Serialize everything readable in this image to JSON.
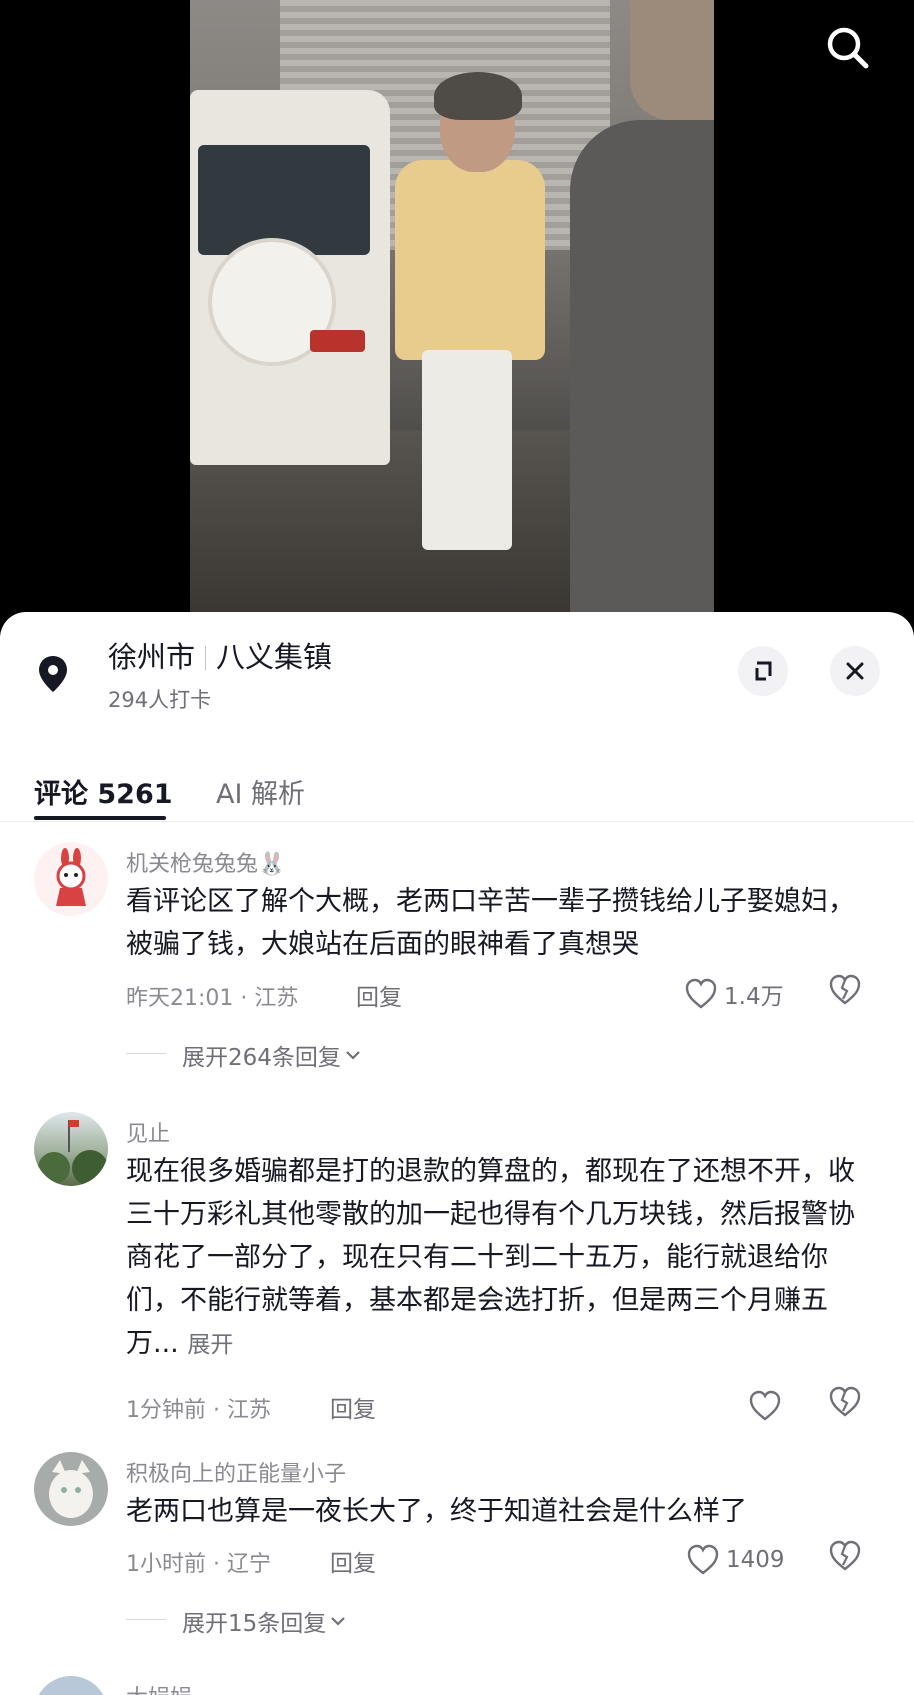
{
  "location": {
    "city": "徐州市",
    "place": "八义集镇",
    "checkins": "294人打卡"
  },
  "tabs": {
    "comments": "评论 5261",
    "ai": "AI 解析"
  },
  "comments": [
    {
      "username": "机关枪兔兔兔🐰",
      "text": "看评论区了解个大概，老两口辛苦一辈子攒钱给儿子娶媳妇，被骗了钱，大娘站在后面的眼神看了真想哭",
      "time": "昨天21:01",
      "region": "江苏",
      "reply": "回复",
      "likes": "1.4万",
      "expand_replies": "展开264条回复"
    },
    {
      "username": "见止",
      "text": "现在很多婚骗都是打的退款的算盘的，都现在了还想不开，收三十万彩礼其他零散的加一起也得有个几万块钱，然后报警协商花了一部分了，现在只有二十到二十五万，能行就退给你们，不能行就等着，基本都是会选打折，但是两三个月赚五万...",
      "more": "展开",
      "time": "1分钟前",
      "region": "江苏",
      "reply": "回复",
      "likes": ""
    },
    {
      "username": "积极向上的正能量小子",
      "text": "老两口也算是一夜长大了，终于知道社会是什么样了",
      "time": "1小时前",
      "region": "辽宁",
      "reply": "回复",
      "likes": "1409",
      "expand_replies": "展开15条回复"
    },
    {
      "username": "大娟娟"
    }
  ],
  "meta_separator": "·",
  "icons": [
    "search-icon",
    "location-pin-icon",
    "expand-icon",
    "close-icon",
    "heart-icon",
    "broken-heart-icon",
    "chevron-down-icon"
  ],
  "colors": {
    "text": "#161823",
    "secondary": "#8a8b91",
    "sheet": "#ffffff"
  }
}
